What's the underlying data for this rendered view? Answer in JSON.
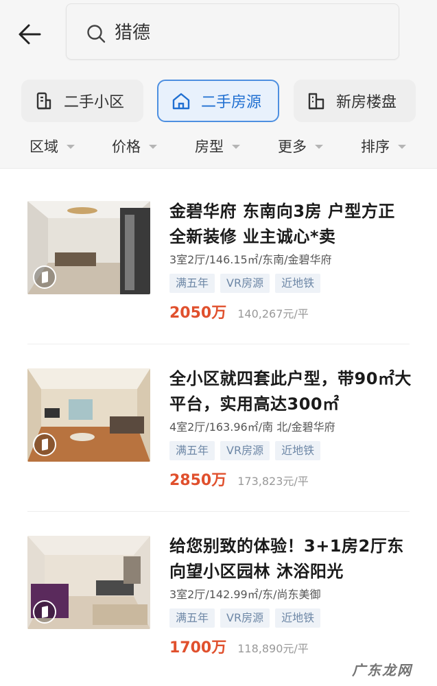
{
  "search": {
    "query": "猎德"
  },
  "tabs": [
    {
      "label": "二手小区",
      "icon": "building-icon",
      "active": false
    },
    {
      "label": "二手房源",
      "icon": "house-icon",
      "active": true
    },
    {
      "label": "新房楼盘",
      "icon": "new-building-icon",
      "active": false
    }
  ],
  "filters": [
    "区域",
    "价格",
    "房型",
    "更多",
    "排序"
  ],
  "listings": [
    {
      "title": "金碧华府 东南向3房 户型方正 全新装修 业主诚心*卖",
      "meta": "3室2厅/146.15㎡/东南/金碧华府",
      "tags": [
        "满五年",
        "VR房源",
        "近地铁"
      ],
      "price": "2050万",
      "unit_price": "140,267元/平"
    },
    {
      "title": "全小区就四套此户型，带90㎡大平台，实用高达300㎡",
      "meta": "4室2厅/163.96㎡/南 北/金碧华府",
      "tags": [
        "满五年",
        "VR房源",
        "近地铁"
      ],
      "price": "2850万",
      "unit_price": "173,823元/平"
    },
    {
      "title": "给您别致的体验！3+1房2厅东向望小区园林 沐浴阳光",
      "meta": "3室2厅/142.99㎡/东/尚东美御",
      "tags": [
        "满五年",
        "VR房源",
        "近地铁"
      ],
      "price": "1700万",
      "unit_price": "118,890元/平"
    }
  ],
  "watermark": "广东龙网",
  "colors": {
    "accent": "#1f6fd1",
    "price": "#e0502d",
    "tag_text": "#6d87a6"
  }
}
